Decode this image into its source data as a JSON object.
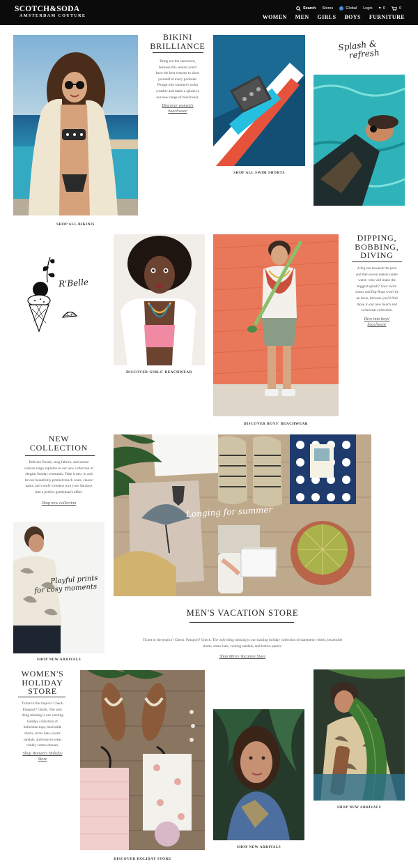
{
  "header": {
    "logo_line1": "SCOTCH&SODA",
    "logo_line2": "AMSTERDAM COUTURE",
    "search_label": "Search",
    "stores_label": "Stores",
    "global_label": "Global",
    "login_label": "Login",
    "wishlist_count": "0",
    "cart_count": "0",
    "nav": [
      "WOMEN",
      "MEN",
      "GIRLS",
      "BOYS",
      "FURNITURE"
    ]
  },
  "section1": {
    "title_line1": "BIKINI",
    "title_line2": "BRILLIANCE",
    "body_lines": [
      "Bring out the sunscreen,",
      "because this season you'll",
      "have the best reasons to show",
      "yourself at every poolside.",
      "Plunge into summer's swim",
      "weather and make a splash in",
      "our new range of beachwear."
    ],
    "link_line1": "Discover women's",
    "link_line2": "beachwear",
    "cap_bikinis": "SHOP ALL BIKINIS",
    "cap_swim": "SHOP ALL SWIM SHORTS",
    "script_line1": "Splash &",
    "script_line2": "refresh"
  },
  "section2": {
    "script_rbelle": "R'Belle",
    "cap_girls": "DISCOVER GIRLS' BEACHWEAR",
    "cap_boys": "DISCOVER BOYS' BEACHWEAR",
    "title_line1": "DIPPING,",
    "title_line2": "BOBBING,",
    "title_line3": "DIVING",
    "body_lines": [
      "A big run towards the pool",
      "and then seven meters under",
      "water: who will make the",
      "biggest splash? Your swim",
      "shorts and flip-flops won't be",
      "an issue, because you'll find",
      "those in our new beach and",
      "swimwear collection."
    ],
    "link_line1": "Dive into boys'",
    "link_line2": "beachwear"
  },
  "section3": {
    "title_line1": "NEW",
    "title_line2": "COLLECTION",
    "body_lines": [
      "Delicate florals, snug fabrics, and serene",
      "colours reign supreme in our new collection of",
      "elegant Sunday essentials. Take it easy in and",
      "let our beautifully printed trench coats, classic",
      "pants, and comfy sweaters turn your Sundays",
      "into a perfect gentleman's affair."
    ],
    "link": "Shop new collection",
    "overlay_line1": "Playful prints",
    "overlay_line2": "for cosy moments",
    "cap_new": "SHOP NEW ARRIVALS",
    "longing": "Longing for summer",
    "vacation_title": "MEN'S VACATION STORE",
    "vacation_body_1": "Ticket to the tropics? Check. Passport? Check. The only thing missing is our sizzling holiday collection of statement t-shirts, beachside",
    "vacation_body_2": "shorts, straw hats, cooling sandals, and festive panels.",
    "vacation_link": "Shop Men's Vacation Store"
  },
  "section4": {
    "title_line1": "WOMEN'S",
    "title_line2": "HOLIDAY",
    "title_line3": "STORE",
    "body_lines": [
      "Ticket to the tropics? Check.",
      "Passport? Check. The only",
      "thing missing is our sizzling",
      "holiday collection of",
      "bohemian tops, beachside",
      "shorts, straw hats, exotic",
      "sandals, and easy-to-wear",
      "crinkly cotton dresses."
    ],
    "link_line1": "Shop Women's Holiday",
    "link_line2": "Store",
    "cap_holiday": "DISCOVER HOLIDAY STORE",
    "cap_new_mid": "SHOP NEW ARRIVALS",
    "cap_new_right": "SHOP NEW ARRIVALS"
  },
  "colors": {
    "header_bg": "#0b0b0b",
    "pool_teal": "#2fb3b8",
    "coral": "#e9785a",
    "link_gray": "#555555"
  }
}
